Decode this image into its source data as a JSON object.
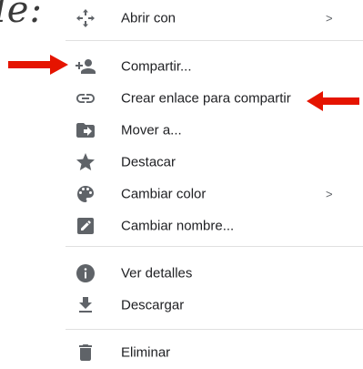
{
  "background": {
    "fragment_text": "le:"
  },
  "menu": {
    "items": [
      {
        "label": "Abrir con",
        "icon": "move-arrows-icon",
        "has_submenu": true,
        "chevron": ">"
      },
      {
        "label": "Compartir...",
        "icon": "person-add-icon"
      },
      {
        "label": "Crear enlace para compartir",
        "icon": "link-icon"
      },
      {
        "label": "Mover a...",
        "icon": "folder-move-icon"
      },
      {
        "label": "Destacar",
        "icon": "star-icon"
      },
      {
        "label": "Cambiar color",
        "icon": "palette-icon",
        "has_submenu": true,
        "chevron": ">"
      },
      {
        "label": "Cambiar nombre...",
        "icon": "edit-icon"
      },
      {
        "label": "Ver detalles",
        "icon": "info-icon"
      },
      {
        "label": "Descargar",
        "icon": "download-icon"
      },
      {
        "label": "Eliminar",
        "icon": "trash-icon"
      }
    ]
  },
  "annotations": {
    "arrow_color": "#e51400"
  },
  "colors": {
    "icon": "#5f6368",
    "text": "#202124",
    "divider": "#e0e0e0"
  }
}
